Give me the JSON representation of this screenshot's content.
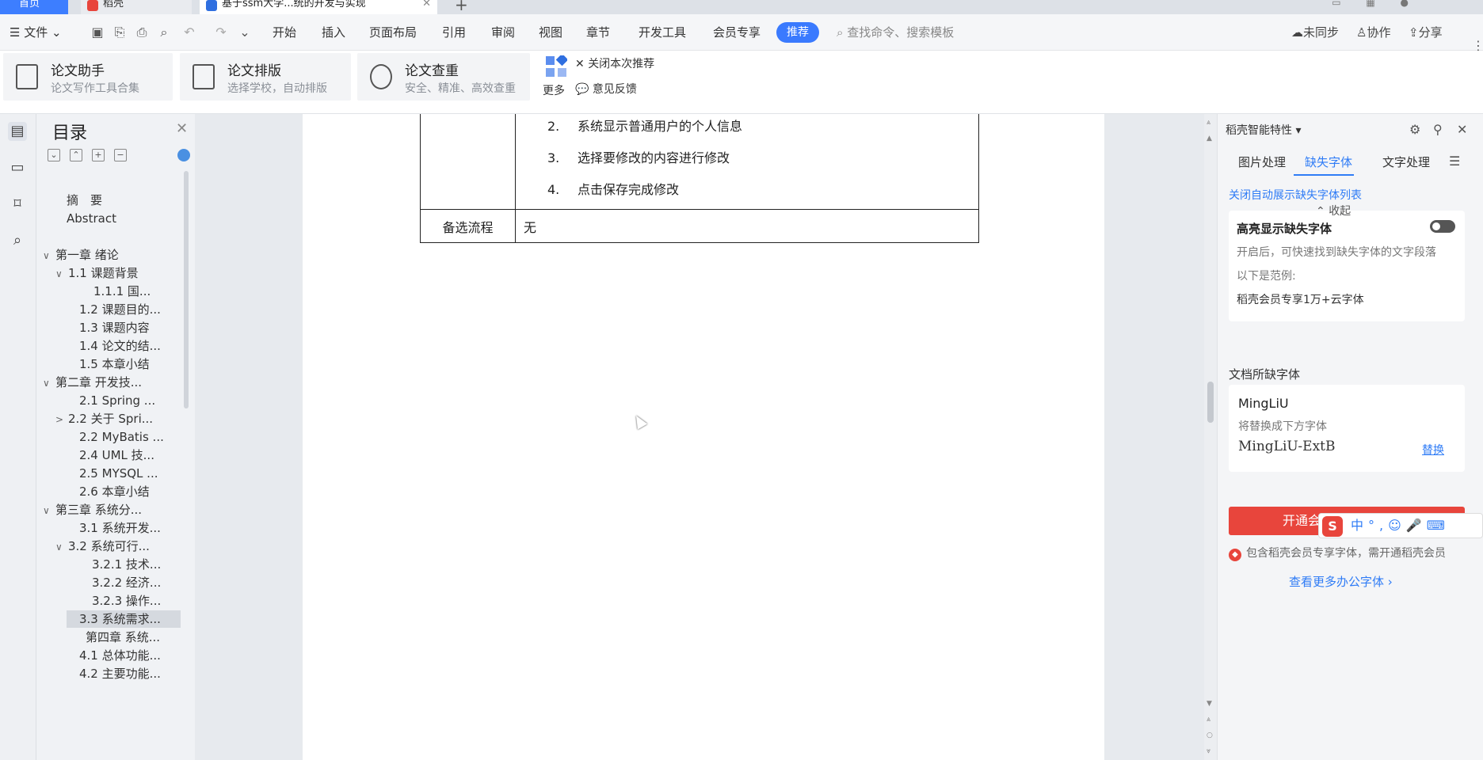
{
  "tabs": {
    "home": "首页",
    "daoke": "稻壳",
    "doc": "基于ssm大学...统的开发与实现"
  },
  "menu": {
    "file": "文件",
    "items": [
      "开始",
      "插入",
      "页面布局",
      "引用",
      "审阅",
      "视图",
      "章节",
      "开发工具",
      "会员专享"
    ],
    "recommend": "推荐",
    "search_placeholder": "查找命令、搜索模板",
    "unsynced": "未同步",
    "collab": "协作",
    "share": "分享"
  },
  "ribbon": {
    "cards": [
      {
        "title": "论文助手",
        "sub": "论文写作工具合集"
      },
      {
        "title": "论文排版",
        "sub": "选择学校，自动排版"
      },
      {
        "title": "论文查重",
        "sub": "安全、精准、高效查重"
      }
    ],
    "more": "更多",
    "close_rec": "关闭本次推荐",
    "feedback": "意见反馈"
  },
  "toc": {
    "title": "目录",
    "items": [
      {
        "label": "摘　要",
        "arrow": ""
      },
      {
        "label": "Abstract",
        "arrow": ""
      },
      {
        "label": "第一章  绪论",
        "arrow": "∨"
      },
      {
        "label": "1.1    课题背景",
        "arrow": "∨"
      },
      {
        "label": "1.1.1 国...",
        "arrow": ""
      },
      {
        "label": "1.2    课题目的...",
        "arrow": ""
      },
      {
        "label": "1.3    课题内容",
        "arrow": ""
      },
      {
        "label": "1.4    论文的结...",
        "arrow": ""
      },
      {
        "label": "1.5    本章小结",
        "arrow": ""
      },
      {
        "label": "第二章    开发技...",
        "arrow": "∨"
      },
      {
        "label": "2.1    Spring ...",
        "arrow": ""
      },
      {
        "label": "2.2    关于 Spri...",
        "arrow": ">"
      },
      {
        "label": "2.2  MyBatis ...",
        "arrow": ""
      },
      {
        "label": "2.4    UML 技...",
        "arrow": ""
      },
      {
        "label": "2.5    MYSQL ...",
        "arrow": ""
      },
      {
        "label": "2.6    本章小结",
        "arrow": ""
      },
      {
        "label": "第三章    系统分...",
        "arrow": "∨"
      },
      {
        "label": "3.1    系统开发...",
        "arrow": ""
      },
      {
        "label": "3.2 系统可行...",
        "arrow": "∨"
      },
      {
        "label": "3.2.1 技术...",
        "arrow": ""
      },
      {
        "label": "3.2.2 经济...",
        "arrow": ""
      },
      {
        "label": "3.2.3 操作...",
        "arrow": ""
      },
      {
        "label": "3.3    系统需求...",
        "arrow": ""
      },
      {
        "label": "第四章  系统...",
        "arrow": ""
      },
      {
        "label": "4.1    总体功能...",
        "arrow": ""
      },
      {
        "label": "4.2    主要功能...",
        "arrow": ""
      }
    ]
  },
  "document": {
    "steps": [
      {
        "num": "2.",
        "text": "系统显示普通用户的个人信息"
      },
      {
        "num": "3.",
        "text": "选择要修改的内容进行修改"
      },
      {
        "num": "4.",
        "text": "点击保存完成修改"
      }
    ],
    "alt_label": "备选流程",
    "alt_value": "无"
  },
  "panel": {
    "title": "稻壳智能特性",
    "tabs": [
      "图片处理",
      "缺失字体",
      "文字处理"
    ],
    "close_auto": "关闭自动展示缺失字体列表",
    "highlight_title": "高亮显示缺失字体",
    "highlight_desc": "开启后，可快速找到缺失字体的文字段落",
    "example_label": "以下是范例:",
    "example_text": "稻壳会员专享1万+云字体",
    "collapse": "收起",
    "missing_fonts_title": "文档所缺字体",
    "font_name": "MingLiU",
    "replace_hint": "将替换成下方字体",
    "replacement_font": "MingLiU-ExtB",
    "replace_btn": "替换",
    "open_btn": "开通会员",
    "note": "包含稻壳会员专享字体，需开通稻壳会员",
    "more_fonts": "查看更多办公字体"
  },
  "ime": {
    "lang": "中"
  },
  "colors": {
    "accent": "#3a7afe",
    "red": "#e8453c"
  }
}
